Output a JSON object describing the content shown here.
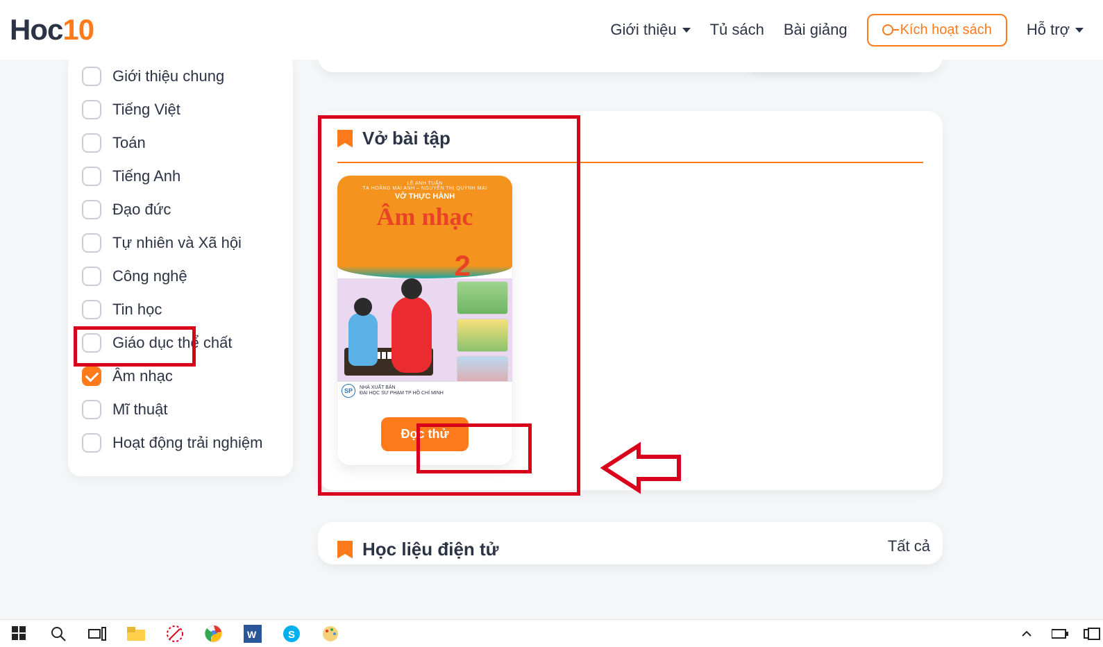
{
  "logo": {
    "part1": "Hoc",
    "part2": "10"
  },
  "nav": {
    "intro": "Giới thiệu",
    "bookshelf": "Tủ sách",
    "lectures": "Bài giảng",
    "activate": "Kích hoạt sách",
    "support": "Hỗ trợ"
  },
  "sidebar": {
    "items": [
      {
        "label": "Giới thiệu chung",
        "checked": false
      },
      {
        "label": "Tiếng Việt",
        "checked": false
      },
      {
        "label": "Toán",
        "checked": false
      },
      {
        "label": "Tiếng Anh",
        "checked": false
      },
      {
        "label": "Đạo đức",
        "checked": false
      },
      {
        "label": "Tự nhiên và Xã hội",
        "checked": false
      },
      {
        "label": "Công nghệ",
        "checked": false
      },
      {
        "label": "Tin học",
        "checked": false
      },
      {
        "label": "Giáo dục thể chất",
        "checked": false
      },
      {
        "label": "Âm nhạc",
        "checked": true
      },
      {
        "label": "Mĩ thuật",
        "checked": false
      },
      {
        "label": "Hoạt động trải nghiệm",
        "checked": false
      }
    ]
  },
  "section1": {
    "title": "Vở bài tập",
    "book": {
      "authors_small": "LÊ ANH TUẤN",
      "authors_line": "TẠ HOÀNG MAI ANH – NGUYỄN THỊ QUỲNH MAI",
      "subtitle": "VỞ THỰC HÀNH",
      "title": "Âm nhạc",
      "grade": "2",
      "publisher_line1": "NHÀ XUẤT BẢN",
      "publisher_line2": "ĐẠI HỌC SƯ PHẠM TP HỒ CHÍ MINH",
      "read_label": "Đọc thử"
    }
  },
  "section2": {
    "title": "Học liệu điện tử",
    "view_all": "Tất cả"
  }
}
